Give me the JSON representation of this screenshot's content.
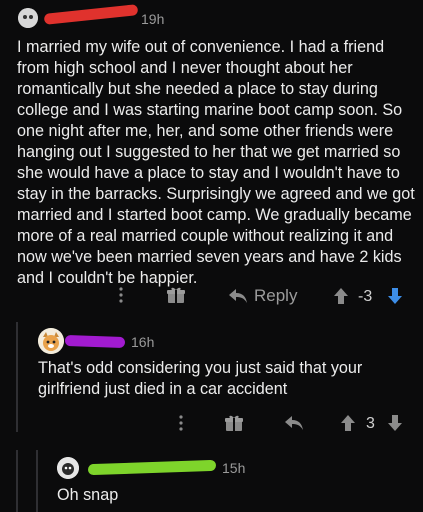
{
  "comments": [
    {
      "time": "19h",
      "text": "I married my wife out of convenience. I had a friend from high school and I never thought about her romantically but she needed a place to stay during college and I was starting marine boot camp soon. So one night after me, her, and some other friends were hanging out I suggested to her that we get married so she would have a place to stay and I wouldn't have to stay in the barracks. Surprisingly we agreed and we got married and I started boot camp. We gradually became more of a real married couple without realizing it and now we've been married seven years and have 2 kids and I couldn't be happier.",
      "reply_label": "Reply",
      "score": "-3",
      "redaction_color": "#e0322d"
    },
    {
      "time": "16h",
      "text": "That's odd considering you just said that your girlfriend just died in a car accident",
      "score": "3",
      "redaction_color": "#a21bd0"
    },
    {
      "time": "15h",
      "text": "Oh snap",
      "redaction_color": "#7ed42b"
    }
  ],
  "icons": [
    "more-icon",
    "award-icon",
    "reply-icon",
    "upvote-icon",
    "downvote-icon"
  ],
  "colors": {
    "downvote_active": "#3d8ee8",
    "background": "#0b0b0c"
  }
}
